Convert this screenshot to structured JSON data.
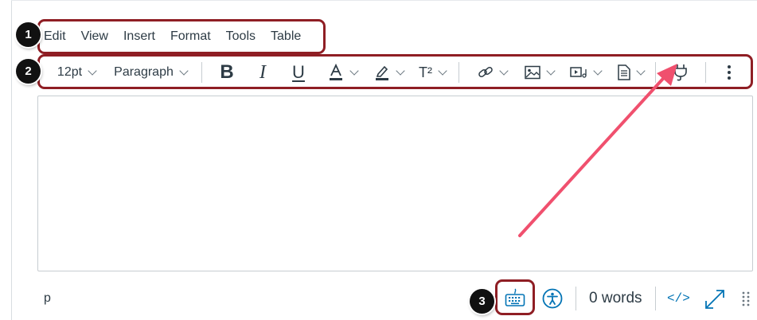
{
  "menubar": {
    "items": [
      "Edit",
      "View",
      "Insert",
      "Format",
      "Tools",
      "Table"
    ]
  },
  "toolbar": {
    "font_size": "12pt",
    "block_format": "Paragraph",
    "bold_label": "B",
    "italic_label": "I",
    "underline_label": "U",
    "superscript_label": "T²",
    "icons": [
      "font-color-icon",
      "highlight-icon",
      "link-icon",
      "image-icon",
      "media-icon",
      "document-icon",
      "apps-plug-icon",
      "more-options-icon"
    ]
  },
  "statusbar": {
    "element_path": "p",
    "word_count": "0 words",
    "html_editor_label": "</>",
    "icons": [
      "keyboard-shortcuts-icon",
      "accessibility-checker-icon",
      "fullscreen-icon",
      "resize-handle-icon"
    ]
  },
  "callouts": {
    "badge_1": "1",
    "badge_2": "2",
    "badge_3": "3"
  },
  "colors": {
    "callout_border": "#8f1e24",
    "arrow": "#f0506e",
    "accent_blue": "#0374b5",
    "text": "#2d3b45"
  }
}
